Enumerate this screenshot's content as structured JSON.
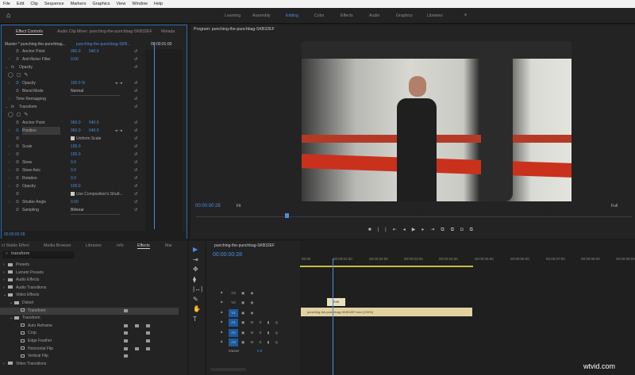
{
  "menu": [
    "File",
    "Edit",
    "Clip",
    "Sequence",
    "Markers",
    "Graphics",
    "View",
    "Window",
    "Help"
  ],
  "workspaces": [
    {
      "label": "Learning",
      "active": false
    },
    {
      "label": "Assembly",
      "active": false
    },
    {
      "label": "Editing",
      "active": true
    },
    {
      "label": "Color",
      "active": false
    },
    {
      "label": "Effects",
      "active": false
    },
    {
      "label": "Audio",
      "active": false
    },
    {
      "label": "Graphics",
      "active": false
    },
    {
      "label": "Libraries",
      "active": false
    }
  ],
  "workspace_more": "»",
  "effect_controls": {
    "tabs": [
      "Effect Controls",
      "Audio Clip Mixer: punching-the-punchbag-SKB32EF",
      "Metada"
    ],
    "master": "Master * punching-the-punchbag...",
    "clip": "punching-the-punchbag-SKB...",
    "ruler_time": "00:00:01:00",
    "timecode": "00:00:00:28",
    "rows": [
      {
        "label": "Anchor Point",
        "v1": "960.0",
        "v2": "540.0",
        "indent": 1
      },
      {
        "label": "Anti-flicker Filter",
        "v1": "0.00",
        "chev": true,
        "indent": 1
      },
      {
        "label": "Opacity",
        "fx": true
      },
      {
        "masks": true
      },
      {
        "label": "Opacity",
        "v1": "100.0 %",
        "chev": true,
        "indent": 1,
        "kf": true
      },
      {
        "label": "Blend Mode",
        "dd": "Normal",
        "indent": 2
      },
      {
        "label": "Time Remapping",
        "chev": true
      },
      {
        "label": "Transform",
        "fx": true
      },
      {
        "masks": true
      },
      {
        "label": "Anchor Point",
        "v1": "960.0",
        "v2": "540.0",
        "indent": 1
      },
      {
        "label": "Position",
        "v1": "960.0",
        "v2": "540.0",
        "chev": true,
        "indent": 1,
        "hl": true,
        "kf": true
      },
      {
        "check": "Uniform Scale",
        "indent": 1
      },
      {
        "label": "Scale",
        "v1": "100.0",
        "chev": true,
        "indent": 1
      },
      {
        "label": "",
        "v1": "100.0",
        "chev": true,
        "indent": 1
      },
      {
        "label": "Skew",
        "v1": "0.0",
        "chev": true,
        "indent": 1
      },
      {
        "label": "Skew Axis",
        "v1": "0.0",
        "chev": true,
        "indent": 1
      },
      {
        "label": "Rotation",
        "v1": "0.0",
        "chev": true,
        "indent": 1
      },
      {
        "label": "Opacity",
        "v1": "100.0",
        "chev": true,
        "indent": 1
      },
      {
        "check": "Use Composition's Shutt...",
        "indent": 1
      },
      {
        "label": "Shutter Angle",
        "v1": "0.00",
        "chev": true,
        "indent": 1
      },
      {
        "label": "Sampling",
        "dd": "Bilinear",
        "indent": 1
      }
    ]
  },
  "program": {
    "title": "Program: punching-the-punchbag-SKB32EF",
    "timecode": "00:00:00:28",
    "fit": "Fit",
    "quality": "Full"
  },
  "effects_panel": {
    "tabs": [
      "ct Stable Effect",
      "Media Browser",
      "Libraries",
      "Info",
      "Effects",
      "Mar"
    ],
    "search": "transform",
    "tree": [
      {
        "label": "Presets",
        "level": 0,
        "type": "folder",
        "chev": ">"
      },
      {
        "label": "Lumetri Presets",
        "level": 0,
        "type": "folder",
        "chev": ">"
      },
      {
        "label": "Audio Effects",
        "level": 0,
        "type": "folder",
        "chev": ">"
      },
      {
        "label": "Audio Transitions",
        "level": 0,
        "type": "folder",
        "chev": ">"
      },
      {
        "label": "Video Effects",
        "level": 0,
        "type": "folder",
        "chev": "v"
      },
      {
        "label": "Distort",
        "level": 1,
        "type": "folder",
        "chev": "v"
      },
      {
        "label": "Transform",
        "level": 2,
        "type": "effect",
        "badges": 1,
        "selected": true
      },
      {
        "label": "Transform",
        "level": 1,
        "type": "folder",
        "chev": "v"
      },
      {
        "label": "Auto Reframe",
        "level": 2,
        "type": "effect",
        "badges": 3
      },
      {
        "label": "Crop",
        "level": 2,
        "type": "effect",
        "badges": 2
      },
      {
        "label": "Edge Feather",
        "level": 2,
        "type": "effect",
        "badges": 2
      },
      {
        "label": "Horizontal Flip",
        "level": 2,
        "type": "effect",
        "badges": 3
      },
      {
        "label": "Vertical Flip",
        "level": 2,
        "type": "effect",
        "badges": 1
      },
      {
        "label": "Video Transitions",
        "level": 0,
        "type": "folder",
        "chev": ">"
      }
    ]
  },
  "timeline": {
    "title": "punching-the-punchbag-SKB32EF",
    "timecode": "00:00:00:28",
    "ruler": [
      "00:00",
      "00:00:01:00",
      "00:00:02:00",
      "00:00:03:00",
      "00:00:04:00",
      "00:00:05:00",
      "00:00:06:00",
      "00:00:07:00",
      "00:00:08:00",
      "00:00:09:00"
    ],
    "tracks": [
      {
        "name": "V3",
        "on": false,
        "type": "v"
      },
      {
        "name": "V2",
        "on": false,
        "type": "v"
      },
      {
        "name": "V1",
        "on": true,
        "type": "v"
      },
      {
        "name": "A1",
        "on": true,
        "type": "a"
      },
      {
        "name": "A2",
        "on": true,
        "type": "a"
      },
      {
        "name": "A3",
        "on": true,
        "type": "a"
      }
    ],
    "master": {
      "label": "Master",
      "value": "0.0"
    },
    "clip_v1": "punching-the-punchbag-SKB32EF.mov [200%]",
    "clip_v2": "Edit"
  },
  "watermark": "wtvid.com",
  "colors": {
    "accent": "#4c8ed8",
    "clip": "#e2d2a0",
    "border": "#2d6bb0"
  }
}
